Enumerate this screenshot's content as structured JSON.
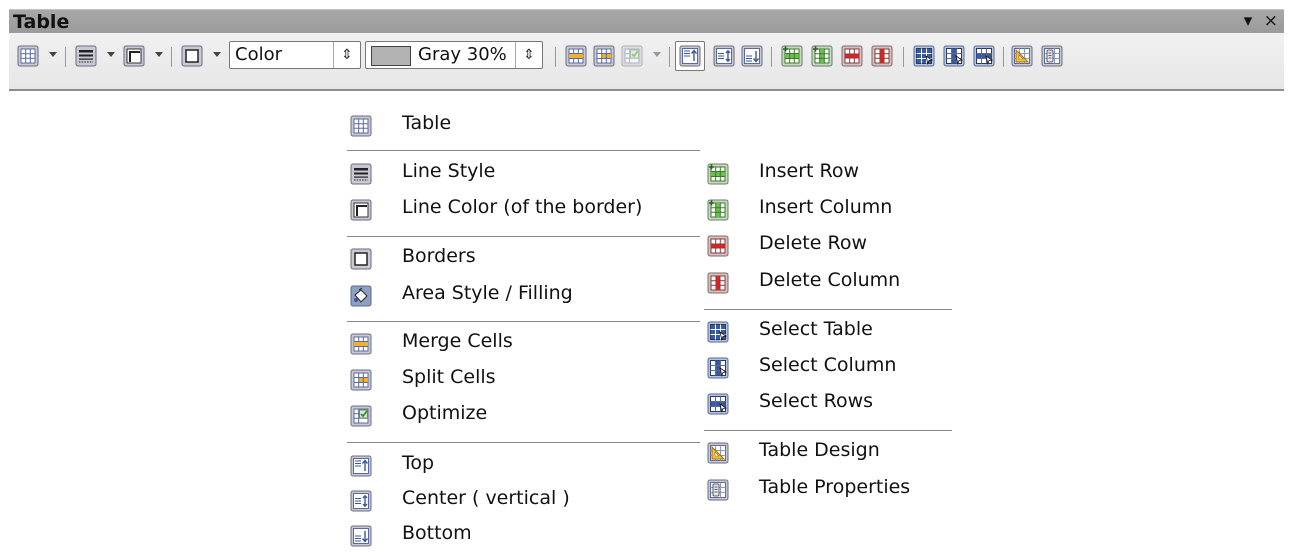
{
  "toolbar": {
    "title": "Table",
    "menu_glyph": "▾",
    "close_glyph": "×",
    "fill_select": {
      "value": "Color"
    },
    "color_select": {
      "value": "Gray 30%",
      "swatch": "#b3b3b3"
    }
  },
  "legend": {
    "left": [
      {
        "icon": "table-icon",
        "label": "Table"
      },
      {
        "icon": "line-style-icon",
        "label": "Line Style"
      },
      {
        "icon": "line-color-icon",
        "label": "Line Color (of the border)"
      },
      {
        "icon": "borders-icon",
        "label": "Borders"
      },
      {
        "icon": "area-style-icon",
        "label": "Area Style / Filling"
      },
      {
        "icon": "merge-cells-icon",
        "label": "Merge Cells"
      },
      {
        "icon": "split-cells-icon",
        "label": "Split Cells"
      },
      {
        "icon": "optimize-icon",
        "label": "Optimize"
      },
      {
        "icon": "align-top-icon",
        "label": "Top"
      },
      {
        "icon": "align-center-icon",
        "label": "Center ( vertical )"
      },
      {
        "icon": "align-bottom-icon",
        "label": "Bottom"
      }
    ],
    "right": [
      {
        "icon": "insert-row-icon",
        "label": "Insert Row"
      },
      {
        "icon": "insert-column-icon",
        "label": "Insert Column"
      },
      {
        "icon": "delete-row-icon",
        "label": "Delete Row"
      },
      {
        "icon": "delete-column-icon",
        "label": "Delete Column"
      },
      {
        "icon": "select-table-icon",
        "label": "Select Table"
      },
      {
        "icon": "select-column-icon",
        "label": "Select Column"
      },
      {
        "icon": "select-rows-icon",
        "label": "Select Rows"
      },
      {
        "icon": "table-design-icon",
        "label": "Table Design"
      },
      {
        "icon": "table-properties-icon",
        "label": "Table Properties"
      }
    ]
  },
  "colors": {
    "title_bar": "#a0a0a0",
    "insert_green": "#3a9a2a",
    "delete_red": "#cc2222",
    "merge_orange": "#e8a020",
    "select_blue": "#3a5aa0"
  }
}
